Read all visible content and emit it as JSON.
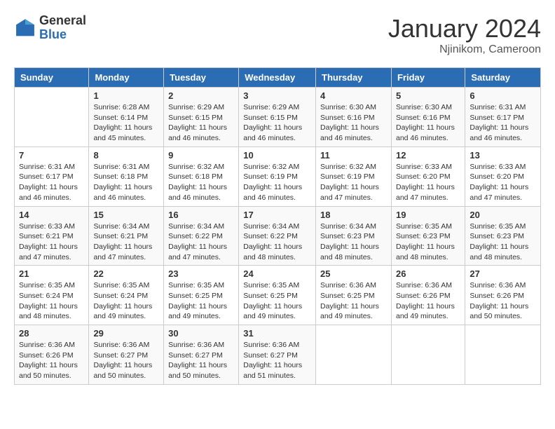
{
  "logo": {
    "general": "General",
    "blue": "Blue"
  },
  "title": "January 2024",
  "location": "Njinikom, Cameroon",
  "headers": [
    "Sunday",
    "Monday",
    "Tuesday",
    "Wednesday",
    "Thursday",
    "Friday",
    "Saturday"
  ],
  "weeks": [
    [
      {
        "day": "",
        "sunrise": "",
        "sunset": "",
        "daylight": ""
      },
      {
        "day": "1",
        "sunrise": "Sunrise: 6:28 AM",
        "sunset": "Sunset: 6:14 PM",
        "daylight": "Daylight: 11 hours and 45 minutes."
      },
      {
        "day": "2",
        "sunrise": "Sunrise: 6:29 AM",
        "sunset": "Sunset: 6:15 PM",
        "daylight": "Daylight: 11 hours and 46 minutes."
      },
      {
        "day": "3",
        "sunrise": "Sunrise: 6:29 AM",
        "sunset": "Sunset: 6:15 PM",
        "daylight": "Daylight: 11 hours and 46 minutes."
      },
      {
        "day": "4",
        "sunrise": "Sunrise: 6:30 AM",
        "sunset": "Sunset: 6:16 PM",
        "daylight": "Daylight: 11 hours and 46 minutes."
      },
      {
        "day": "5",
        "sunrise": "Sunrise: 6:30 AM",
        "sunset": "Sunset: 6:16 PM",
        "daylight": "Daylight: 11 hours and 46 minutes."
      },
      {
        "day": "6",
        "sunrise": "Sunrise: 6:31 AM",
        "sunset": "Sunset: 6:17 PM",
        "daylight": "Daylight: 11 hours and 46 minutes."
      }
    ],
    [
      {
        "day": "7",
        "sunrise": "Sunrise: 6:31 AM",
        "sunset": "Sunset: 6:17 PM",
        "daylight": "Daylight: 11 hours and 46 minutes."
      },
      {
        "day": "8",
        "sunrise": "Sunrise: 6:31 AM",
        "sunset": "Sunset: 6:18 PM",
        "daylight": "Daylight: 11 hours and 46 minutes."
      },
      {
        "day": "9",
        "sunrise": "Sunrise: 6:32 AM",
        "sunset": "Sunset: 6:18 PM",
        "daylight": "Daylight: 11 hours and 46 minutes."
      },
      {
        "day": "10",
        "sunrise": "Sunrise: 6:32 AM",
        "sunset": "Sunset: 6:19 PM",
        "daylight": "Daylight: 11 hours and 46 minutes."
      },
      {
        "day": "11",
        "sunrise": "Sunrise: 6:32 AM",
        "sunset": "Sunset: 6:19 PM",
        "daylight": "Daylight: 11 hours and 47 minutes."
      },
      {
        "day": "12",
        "sunrise": "Sunrise: 6:33 AM",
        "sunset": "Sunset: 6:20 PM",
        "daylight": "Daylight: 11 hours and 47 minutes."
      },
      {
        "day": "13",
        "sunrise": "Sunrise: 6:33 AM",
        "sunset": "Sunset: 6:20 PM",
        "daylight": "Daylight: 11 hours and 47 minutes."
      }
    ],
    [
      {
        "day": "14",
        "sunrise": "Sunrise: 6:33 AM",
        "sunset": "Sunset: 6:21 PM",
        "daylight": "Daylight: 11 hours and 47 minutes."
      },
      {
        "day": "15",
        "sunrise": "Sunrise: 6:34 AM",
        "sunset": "Sunset: 6:21 PM",
        "daylight": "Daylight: 11 hours and 47 minutes."
      },
      {
        "day": "16",
        "sunrise": "Sunrise: 6:34 AM",
        "sunset": "Sunset: 6:22 PM",
        "daylight": "Daylight: 11 hours and 47 minutes."
      },
      {
        "day": "17",
        "sunrise": "Sunrise: 6:34 AM",
        "sunset": "Sunset: 6:22 PM",
        "daylight": "Daylight: 11 hours and 48 minutes."
      },
      {
        "day": "18",
        "sunrise": "Sunrise: 6:34 AM",
        "sunset": "Sunset: 6:23 PM",
        "daylight": "Daylight: 11 hours and 48 minutes."
      },
      {
        "day": "19",
        "sunrise": "Sunrise: 6:35 AM",
        "sunset": "Sunset: 6:23 PM",
        "daylight": "Daylight: 11 hours and 48 minutes."
      },
      {
        "day": "20",
        "sunrise": "Sunrise: 6:35 AM",
        "sunset": "Sunset: 6:23 PM",
        "daylight": "Daylight: 11 hours and 48 minutes."
      }
    ],
    [
      {
        "day": "21",
        "sunrise": "Sunrise: 6:35 AM",
        "sunset": "Sunset: 6:24 PM",
        "daylight": "Daylight: 11 hours and 48 minutes."
      },
      {
        "day": "22",
        "sunrise": "Sunrise: 6:35 AM",
        "sunset": "Sunset: 6:24 PM",
        "daylight": "Daylight: 11 hours and 49 minutes."
      },
      {
        "day": "23",
        "sunrise": "Sunrise: 6:35 AM",
        "sunset": "Sunset: 6:25 PM",
        "daylight": "Daylight: 11 hours and 49 minutes."
      },
      {
        "day": "24",
        "sunrise": "Sunrise: 6:35 AM",
        "sunset": "Sunset: 6:25 PM",
        "daylight": "Daylight: 11 hours and 49 minutes."
      },
      {
        "day": "25",
        "sunrise": "Sunrise: 6:36 AM",
        "sunset": "Sunset: 6:25 PM",
        "daylight": "Daylight: 11 hours and 49 minutes."
      },
      {
        "day": "26",
        "sunrise": "Sunrise: 6:36 AM",
        "sunset": "Sunset: 6:26 PM",
        "daylight": "Daylight: 11 hours and 49 minutes."
      },
      {
        "day": "27",
        "sunrise": "Sunrise: 6:36 AM",
        "sunset": "Sunset: 6:26 PM",
        "daylight": "Daylight: 11 hours and 50 minutes."
      }
    ],
    [
      {
        "day": "28",
        "sunrise": "Sunrise: 6:36 AM",
        "sunset": "Sunset: 6:26 PM",
        "daylight": "Daylight: 11 hours and 50 minutes."
      },
      {
        "day": "29",
        "sunrise": "Sunrise: 6:36 AM",
        "sunset": "Sunset: 6:27 PM",
        "daylight": "Daylight: 11 hours and 50 minutes."
      },
      {
        "day": "30",
        "sunrise": "Sunrise: 6:36 AM",
        "sunset": "Sunset: 6:27 PM",
        "daylight": "Daylight: 11 hours and 50 minutes."
      },
      {
        "day": "31",
        "sunrise": "Sunrise: 6:36 AM",
        "sunset": "Sunset: 6:27 PM",
        "daylight": "Daylight: 11 hours and 51 minutes."
      },
      {
        "day": "",
        "sunrise": "",
        "sunset": "",
        "daylight": ""
      },
      {
        "day": "",
        "sunrise": "",
        "sunset": "",
        "daylight": ""
      },
      {
        "day": "",
        "sunrise": "",
        "sunset": "",
        "daylight": ""
      }
    ]
  ]
}
